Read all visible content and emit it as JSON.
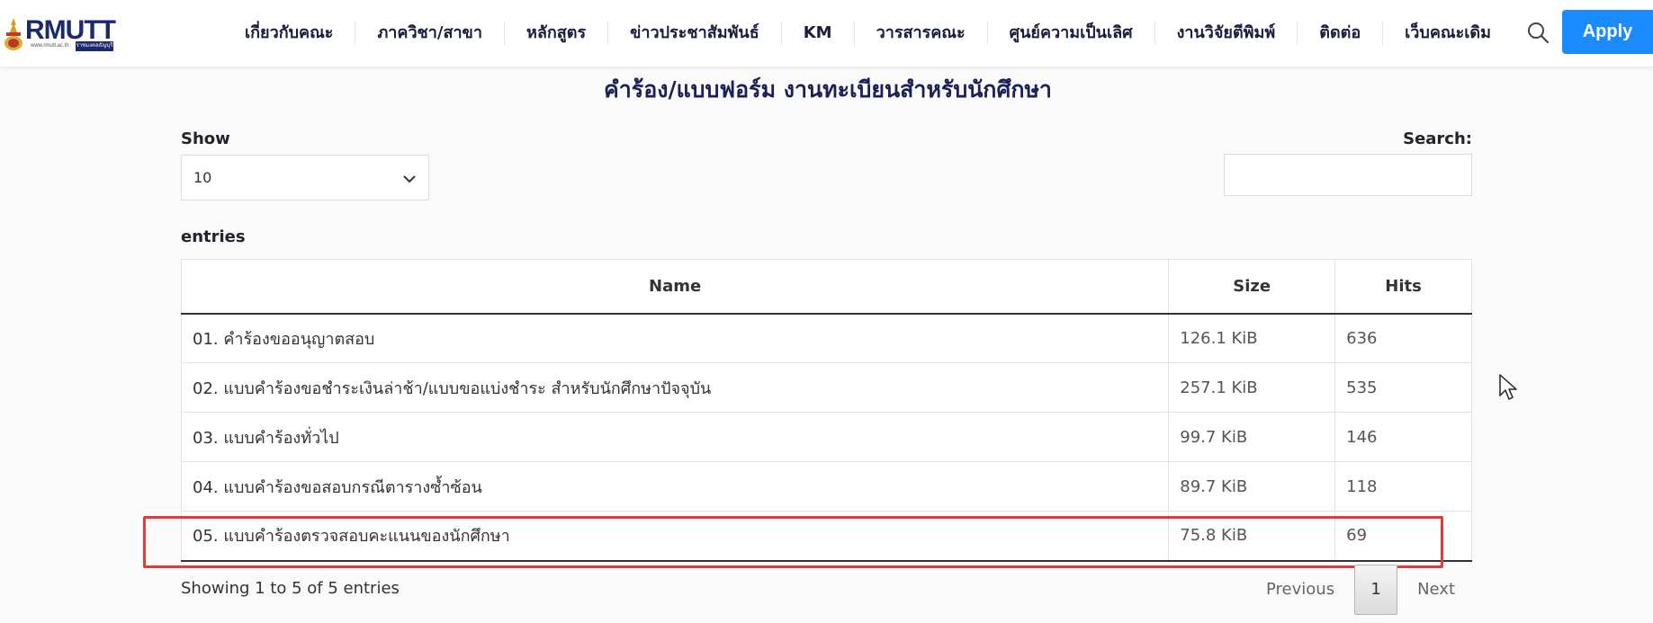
{
  "header": {
    "logo": {
      "name": "RMUTT",
      "subtitle": "www.rmutt.ac.th",
      "subtitle_tag": "ราชมงคลธัญบุรี"
    },
    "nav_items": [
      "เกี่ยวกับคณะ",
      "ภาควิชา/สาขา",
      "หลักสูตร",
      "ข่าวประชาสัมพันธ์",
      "KM",
      "วารสารคณะ",
      "ศูนย์ความเป็นเลิศ",
      "งานวิจัยตีพิมพ์",
      "ติดต่อ",
      "เว็บคณะเดิม"
    ],
    "search_icon": "search-icon",
    "apply_label": "Apply"
  },
  "page": {
    "title": "คำร้อง/แบบฟอร์ม งานทะเบียนสำหรับนักศึกษา"
  },
  "controls": {
    "show_label": "Show",
    "show_value": "10",
    "entries_label": "entries",
    "search_label": "Search:",
    "search_value": ""
  },
  "table": {
    "columns": [
      "Name",
      "Size",
      "Hits"
    ],
    "rows": [
      {
        "name": "01. คำร้องขออนุญาตสอบ",
        "size": "126.1 KiB",
        "hits": "636"
      },
      {
        "name": "02. แบบคำร้องขอชำระเงินล่าช้า/แบบขอแบ่งชำระ สำหรับนักศึกษาปัจจุบัน",
        "size": "257.1 KiB",
        "hits": "535"
      },
      {
        "name": "03. แบบคำร้องทั่วไป",
        "size": "99.7 KiB",
        "hits": "146"
      },
      {
        "name": "04. แบบคำร้องขอสอบกรณีตารางซ้ำซ้อน",
        "size": "89.7 KiB",
        "hits": "118"
      },
      {
        "name": "05. แบบคำร้องตรวจสอบคะแนนของนักศึกษา",
        "size": "75.8 KiB",
        "hits": "69"
      }
    ]
  },
  "footer": {
    "info": "Showing 1 to 5 of 5 entries",
    "previous_label": "Previous",
    "current_page": "1",
    "next_label": "Next"
  },
  "colors": {
    "accent": "#1a8cff",
    "title": "#1b2058",
    "highlight": "#e53935"
  }
}
